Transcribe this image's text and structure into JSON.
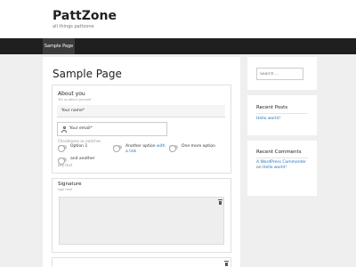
{
  "site": {
    "title": "PattZone",
    "tagline": "all things pattzone"
  },
  "nav": {
    "items": [
      {
        "label": "Sample Page"
      }
    ]
  },
  "page": {
    "title": "Sample Page"
  },
  "form": {
    "about": {
      "title": "About you",
      "subtitle": "Tell us about yourself",
      "name_label": "Your name*",
      "email_label": "Your email*",
      "checkboxes_label": "Checkboxes as switches",
      "options": [
        {
          "label": "Option 1"
        },
        {
          "label_a": "Another option ",
          "label_b": "with a link"
        },
        {
          "label": "One more option"
        },
        {
          "label": "and another"
        }
      ],
      "key_text": "key text"
    },
    "signature": {
      "title": "Signature",
      "subtitle": "sign here"
    }
  },
  "sidebar": {
    "search_placeholder": "Search ...",
    "recent_posts": {
      "title": "Recent Posts",
      "items": [
        "Hello world!"
      ]
    },
    "recent_comments": {
      "title": "Recent Comments",
      "author": "A WordPress Commenter",
      "on": " on ",
      "post": "Hello world!"
    }
  }
}
